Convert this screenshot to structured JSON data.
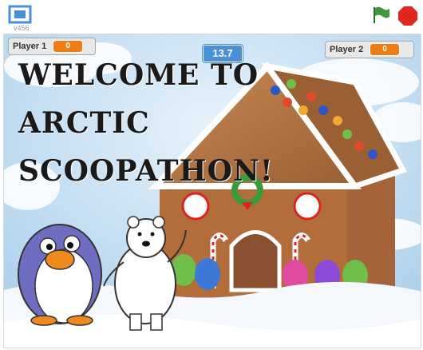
{
  "toolbar": {
    "version": "v456",
    "fullscreen_icon": "fullscreen-icon",
    "green_flag_icon": "green-flag-icon",
    "stop_icon": "stop-icon",
    "colors": {
      "flag": "#3c9a3c",
      "stop": "#e0271e"
    }
  },
  "monitors": {
    "player1": {
      "label": "Player 1",
      "value": "0"
    },
    "player2": {
      "label": "Player 2",
      "value": "0"
    },
    "timer": "13.7"
  },
  "stage": {
    "title_lines": [
      "WELCOME TO",
      "ARCTIC",
      "SCOOPATHON!"
    ],
    "sprites": [
      "penguin",
      "polar-bear",
      "gingerbread-house"
    ]
  }
}
